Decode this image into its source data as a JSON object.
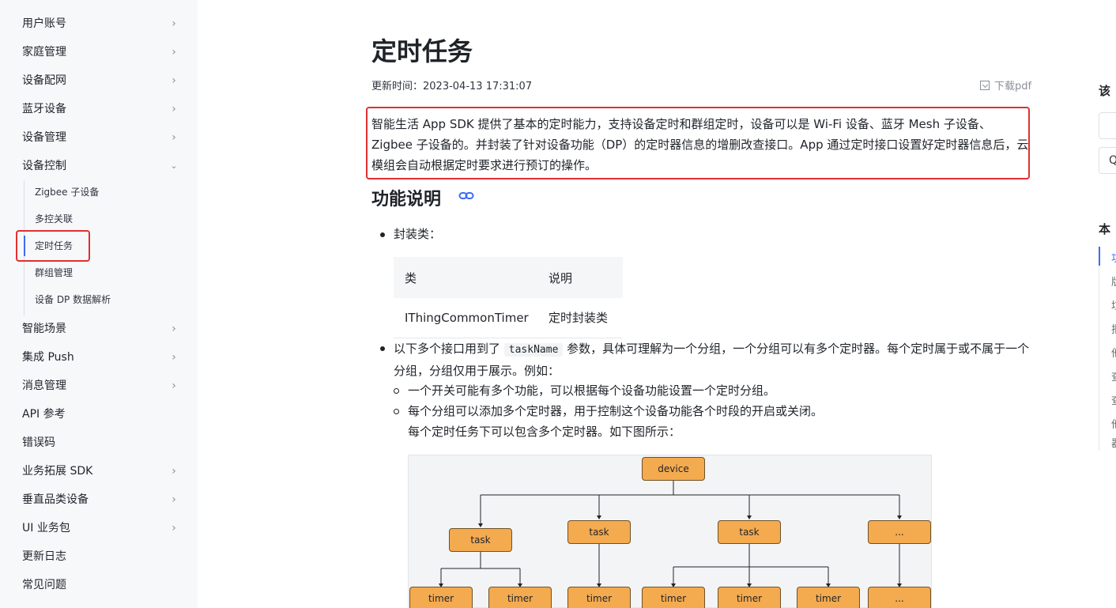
{
  "sidebar": {
    "items": [
      {
        "label": "用户账号",
        "expand": "chevron-right"
      },
      {
        "label": "家庭管理",
        "expand": "chevron-right"
      },
      {
        "label": "设备配网",
        "expand": "chevron-right"
      },
      {
        "label": "蓝牙设备",
        "expand": "chevron-right"
      },
      {
        "label": "设备管理",
        "expand": "chevron-right"
      },
      {
        "label": "设备控制",
        "expand": "chevron-down"
      },
      {
        "label": "智能场景",
        "expand": "chevron-right"
      },
      {
        "label": "集成 Push",
        "expand": "chevron-right"
      },
      {
        "label": "消息管理",
        "expand": "chevron-right"
      },
      {
        "label": "API 参考",
        "expand": ""
      },
      {
        "label": "错误码",
        "expand": ""
      },
      {
        "label": "业务拓展 SDK",
        "expand": "chevron-right"
      },
      {
        "label": "垂直品类设备",
        "expand": "chevron-right"
      },
      {
        "label": "UI 业务包",
        "expand": "chevron-right"
      },
      {
        "label": "更新日志",
        "expand": ""
      },
      {
        "label": "常见问题",
        "expand": ""
      }
    ],
    "sub_items": [
      "Zigbee 子设备",
      "多控关联",
      "定时任务",
      "群组管理",
      "设备 DP 数据解析"
    ],
    "active_sub": "定时任务",
    "accent_color": "#3a6df0"
  },
  "page": {
    "title": "定时任务",
    "updated_label": "更新时间：",
    "updated_value": "2023-04-13 17:31:07",
    "download": "下载pdf",
    "intro": "智能生活 App SDK 提供了基本的定时能力，支持设备定时和群组定时，设备可以是 Wi-Fi 设备、蓝牙 Mesh 子设备、Zigbee 子设备的。并封装了针对设备功能（DP）的定时器信息的增删改查接口。App 通过定时接口设置好定时器信息后，云模组会自动根据定时要求进行预订的操作。",
    "section_title": "功能说明",
    "bullet1": "封装类：",
    "table": {
      "headers": [
        "类",
        "说明"
      ],
      "rows": [
        [
          "IThingCommonTimer",
          "定时封装类"
        ]
      ]
    },
    "bullet2_pre": "以下多个接口用到了 ",
    "bullet2_code": "taskName",
    "bullet2_post": " 参数，具体可理解为一个分组，一个分组可以有多个定时器。每个定时属于或不属于一个分组，分组仅用于展示。例如：",
    "sub_bullet1": "一个开关可能有多个功能，可以根据每个设备功能设置一个定时分组。",
    "sub_bullet2": "每个分组可以添加多个定时器，用于控制这个设备功能各个时段的开启或关闭。",
    "sub_bullet2_cont": "每个定时任务下可以包含多个定时器。如下图所示："
  },
  "diagram": {
    "root": "device",
    "tasks": [
      "task",
      "task",
      "task",
      "..."
    ],
    "timers": [
      "timer",
      "timer",
      "timer",
      "timer",
      "timer",
      "timer",
      "..."
    ],
    "node_color": "#f4aa4f"
  },
  "toc": {
    "title1": "该",
    "box1": "",
    "box2": "𝖰",
    "title2": "本",
    "items": [
      "功",
      "版",
      "垃",
      "批",
      "他",
      "查",
      "查",
      "他",
      "器"
    ]
  },
  "highlight_color": "#e23030"
}
